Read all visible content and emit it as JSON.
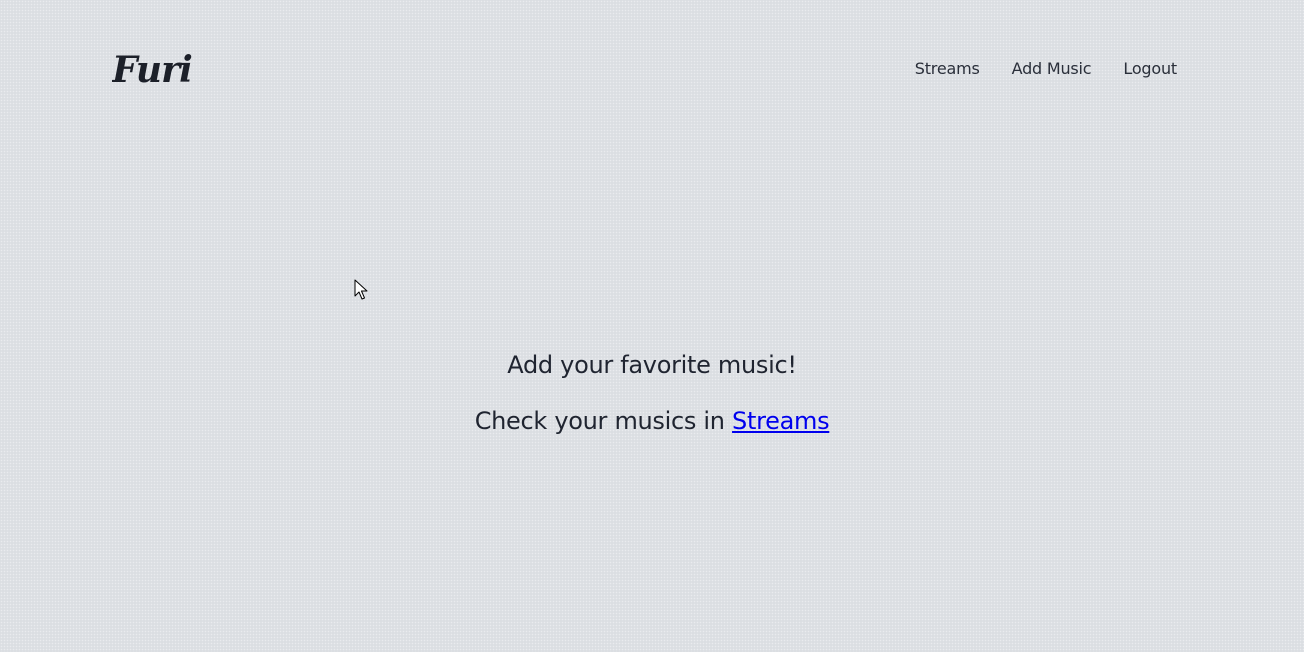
{
  "app": {
    "logo_text": "Furi"
  },
  "nav": {
    "items": [
      {
        "label": "Streams"
      },
      {
        "label": "Add Music"
      },
      {
        "label": "Logout"
      }
    ]
  },
  "main": {
    "headline": "Add your favorite music!",
    "subline_prefix": "Check your musics in ",
    "subline_link": "Streams"
  },
  "colors": {
    "background": "#dee1e5",
    "text": "#1f2430",
    "link": "#0000ee"
  }
}
